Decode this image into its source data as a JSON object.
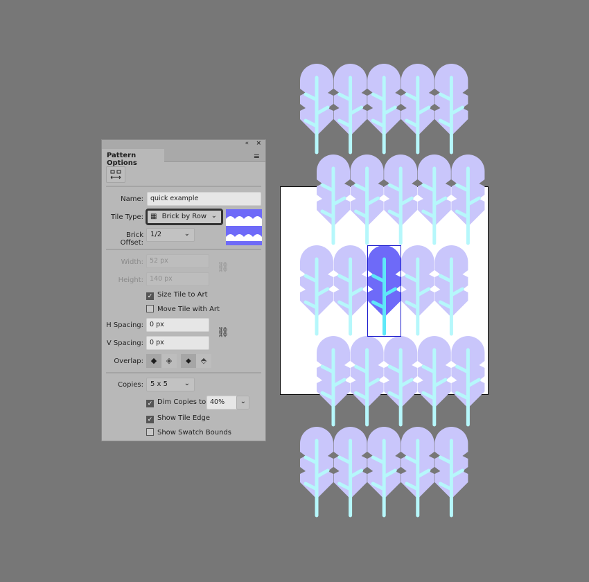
{
  "panel": {
    "title": "Pattern Options",
    "collapse_icon": "«",
    "close_icon": "×",
    "menu_icon": "≡",
    "name_label": "Name:",
    "name_value": "quick example",
    "tile_type_label": "Tile Type:",
    "tile_type_value": "Brick by Row",
    "brick_offset_label": "Brick Offset:",
    "brick_offset_value": "1/2",
    "width_label": "Width:",
    "width_value": "52 px",
    "height_label": "Height:",
    "height_value": "140 px",
    "size_tile_to_art": {
      "label": "Size Tile to Art",
      "checked": true
    },
    "move_tile_with_art": {
      "label": "Move Tile with Art",
      "checked": false
    },
    "h_spacing_label": "H Spacing:",
    "h_spacing_value": "0 px",
    "v_spacing_label": "V Spacing:",
    "v_spacing_value": "0 px",
    "overlap_label": "Overlap:",
    "copies_label": "Copies:",
    "copies_value": "5 x 5",
    "dim_copies": {
      "label": "Dim Copies to:",
      "checked": true,
      "value": "40%"
    },
    "show_tile_edge": {
      "label": "Show Tile Edge",
      "checked": true
    },
    "show_swatch_bounds": {
      "label": "Show Swatch Bounds",
      "checked": false
    }
  },
  "colors": {
    "canopy": "#6e6af8",
    "trunk": "#5ee8f8",
    "canopy_dim": "#c9c6fb",
    "trunk_dim": "#b6f7fb",
    "tile_edge": "#1a1acc"
  }
}
